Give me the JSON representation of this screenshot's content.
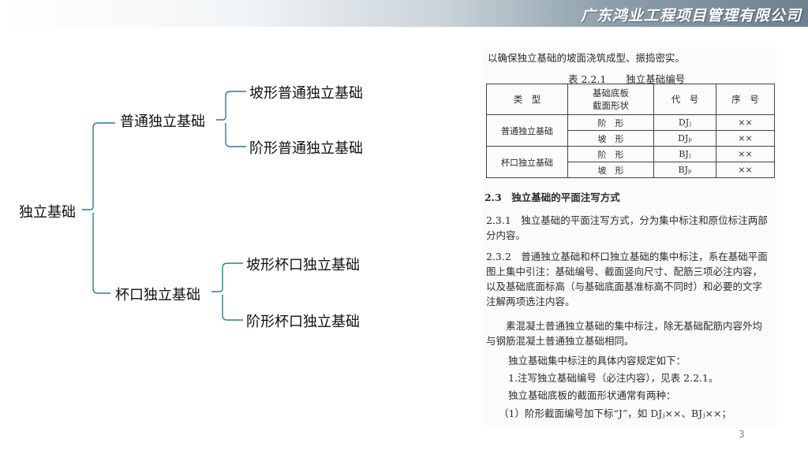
{
  "header": {
    "company": "广东鸿业工程项目管理有限公司"
  },
  "tree": {
    "root": "独立基础",
    "branches": [
      {
        "label": "普通独立基础",
        "children": [
          "坡形普通独立基础",
          "阶形普通独立基础"
        ]
      },
      {
        "label": "杯口独立基础",
        "children": [
          "坡形杯口独立基础",
          "阶形杯口独立基础"
        ]
      }
    ]
  },
  "scan": {
    "intro": "以确保独立基础的坡面浇筑成型、振捣密实。",
    "table_title": "表 2.2.1　　独立基础编号",
    "table_headers": [
      "类　型",
      "基础底板\n截面形状",
      "代　号",
      "序　号"
    ],
    "table_groups": [
      {
        "type": "普通独立基础",
        "rows": [
          [
            "阶　形",
            "DJⱼ",
            "××"
          ],
          [
            "坡　形",
            "DJₚ",
            "××"
          ]
        ]
      },
      {
        "type": "杯口独立基础",
        "rows": [
          [
            "阶　形",
            "BJⱼ",
            "××"
          ],
          [
            "坡　形",
            "BJₚ",
            "××"
          ]
        ]
      }
    ],
    "section_title": "2.3　独立基础的平面注写方式",
    "p1": "2.3.1　独立基础的平面注写方式，分为集中标注和原位标注两部分内容。",
    "p2": "2.3.2　普通独立基础和杯口独立基础的集中标注，系在基础平面图上集中引注：基础编号、截面竖向尺寸、配筋三项必注内容，以及基础底面标高（与基础底面基准标高不同时）和必要的文字注解两项选注内容。",
    "p3": "素混凝土普通独立基础的集中标注，除无基础配筋内容外均与钢筋混凝土普通独立基础相同。",
    "p4": "独立基础集中标注的具体内容规定如下：",
    "p5": "1.注写独立基础编号（必注内容），见表 2.2.1。",
    "p6": "独立基础底板的截面形状通常有两种：",
    "p7": "（1）阶形截面编号加下标“J”，如 DJⱼ××、BJⱼ××；"
  },
  "page_number": "3"
}
